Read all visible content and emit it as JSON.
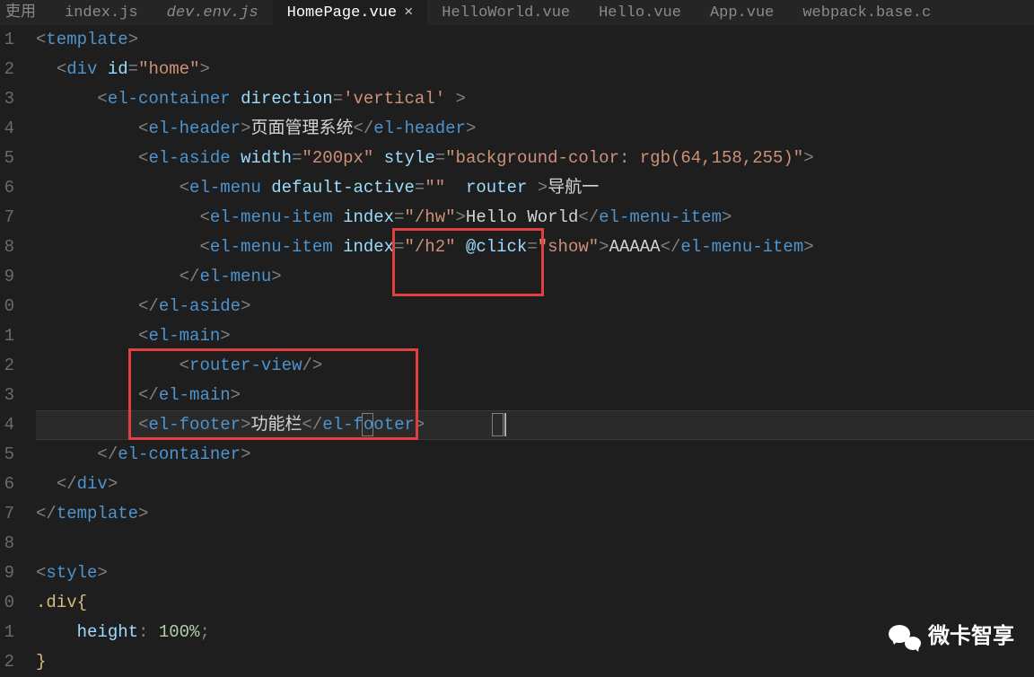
{
  "tabs": {
    "partial_left": "吏用",
    "t0": "index.js",
    "t1": "dev.env.js",
    "t2": "HomePage.vue",
    "t2_close": "×",
    "t3": "HelloWorld.vue",
    "t4": "Hello.vue",
    "t5": "App.vue",
    "t6": "webpack.base.c"
  },
  "gutter": [
    "1",
    "2",
    "3",
    "4",
    "5",
    "6",
    "7",
    "8",
    "9",
    "0",
    "1",
    "2",
    "3",
    "4",
    "5",
    "6",
    "7",
    "8",
    "9",
    "0",
    "1",
    "2"
  ],
  "code": {
    "l1": {
      "tag": "template"
    },
    "l2": {
      "tag": "div",
      "attr": "id",
      "val": "\"home\""
    },
    "l3": {
      "tag": "el-container",
      "attr": "direction",
      "val": "'vertical'"
    },
    "l4": {
      "tag": "el-header",
      "text": "页面管理系统"
    },
    "l5": {
      "tag": "el-aside",
      "attr1": "width",
      "val1": "\"200px\"",
      "attr2": "style",
      "val2": "\"background-color: rgb(64,158,255)\""
    },
    "l6": {
      "tag": "el-menu",
      "attr1": "default-active",
      "val1": "\"\"",
      "attr2": "router",
      "text": "导航一"
    },
    "l7": {
      "tag": "el-menu-item",
      "attr": "index",
      "val": "\"/hw\"",
      "text": "Hello World"
    },
    "l8": {
      "tag": "el-menu-item",
      "attr1": "index",
      "val1": "\"/h2\"",
      "attr2": "@click",
      "val2": "\"show\"",
      "text": "AAAAA"
    },
    "l9": {
      "tag": "el-menu"
    },
    "l10": {
      "tag": "el-aside"
    },
    "l11": {
      "tag": "el-main"
    },
    "l12": {
      "tag": "router-view"
    },
    "l13": {
      "tag": "el-main"
    },
    "l14": {
      "tag": "el-footer",
      "text": "功能栏"
    },
    "l15": {
      "tag": "el-container"
    },
    "l16": {
      "tag": "div"
    },
    "l17": {
      "tag": "template"
    },
    "l19": {
      "tag": "style"
    },
    "l20": {
      "sel": ".div",
      "brace": "{"
    },
    "l21": {
      "prop": "height",
      "val": "100%",
      "semi": ";"
    },
    "l22": {
      "brace": "}"
    }
  },
  "watermark": "微卡智享"
}
